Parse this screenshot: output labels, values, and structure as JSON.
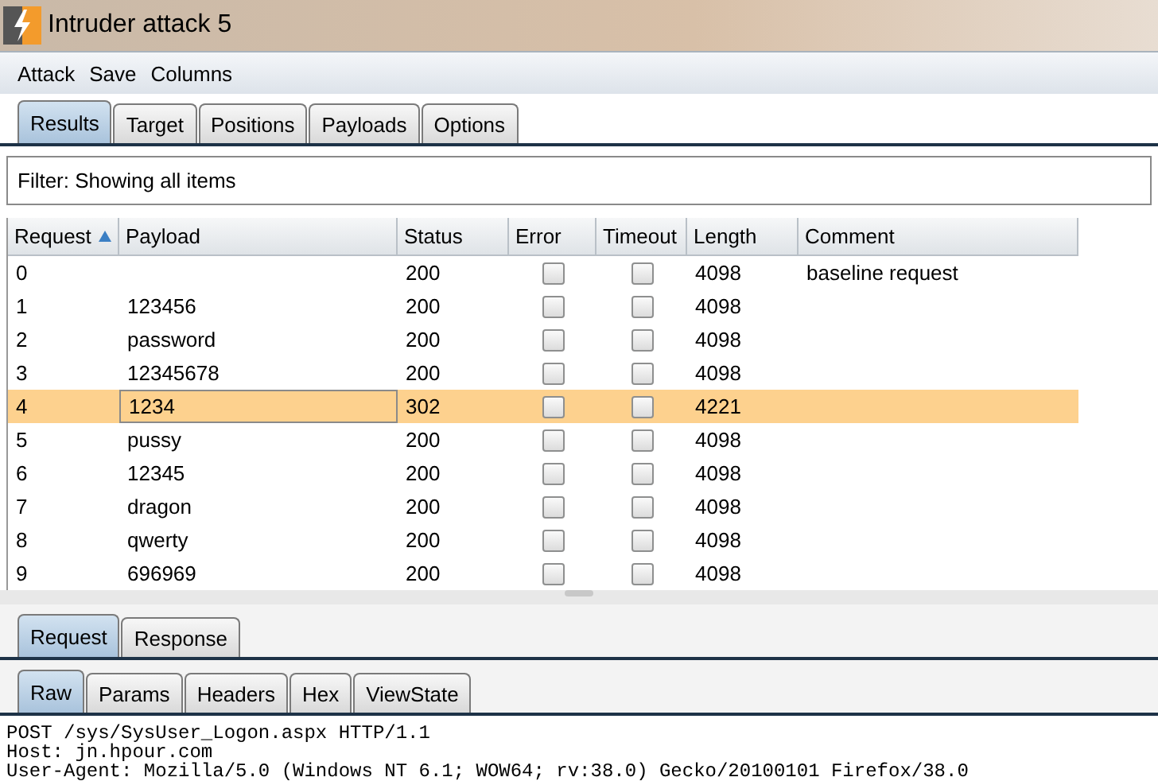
{
  "window": {
    "title": "Intruder attack 5"
  },
  "menu": [
    "Attack",
    "Save",
    "Columns"
  ],
  "tabs": [
    {
      "label": "Results",
      "selected": true
    },
    {
      "label": "Target",
      "selected": false
    },
    {
      "label": "Positions",
      "selected": false
    },
    {
      "label": "Payloads",
      "selected": false
    },
    {
      "label": "Options",
      "selected": false
    }
  ],
  "filter": "Filter: Showing all items",
  "table": {
    "columns": [
      {
        "label": "Request",
        "sorted": true
      },
      {
        "label": "Payload",
        "sorted": false
      },
      {
        "label": "Status",
        "sorted": false
      },
      {
        "label": "Error",
        "sorted": false
      },
      {
        "label": "Timeout",
        "sorted": false
      },
      {
        "label": "Length",
        "sorted": false
      },
      {
        "label": "Comment",
        "sorted": false
      }
    ],
    "rows": [
      {
        "request": "0",
        "payload": "",
        "status": "200",
        "error": false,
        "timeout": false,
        "length": "4098",
        "comment": "baseline request",
        "selected": false
      },
      {
        "request": "1",
        "payload": "123456",
        "status": "200",
        "error": false,
        "timeout": false,
        "length": "4098",
        "comment": "",
        "selected": false
      },
      {
        "request": "2",
        "payload": "password",
        "status": "200",
        "error": false,
        "timeout": false,
        "length": "4098",
        "comment": "",
        "selected": false
      },
      {
        "request": "3",
        "payload": "12345678",
        "status": "200",
        "error": false,
        "timeout": false,
        "length": "4098",
        "comment": "",
        "selected": false
      },
      {
        "request": "4",
        "payload": "1234",
        "status": "302",
        "error": false,
        "timeout": false,
        "length": "4221",
        "comment": "",
        "selected": true
      },
      {
        "request": "5",
        "payload": "pussy",
        "status": "200",
        "error": false,
        "timeout": false,
        "length": "4098",
        "comment": "",
        "selected": false
      },
      {
        "request": "6",
        "payload": "12345",
        "status": "200",
        "error": false,
        "timeout": false,
        "length": "4098",
        "comment": "",
        "selected": false
      },
      {
        "request": "7",
        "payload": "dragon",
        "status": "200",
        "error": false,
        "timeout": false,
        "length": "4098",
        "comment": "",
        "selected": false
      },
      {
        "request": "8",
        "payload": "qwerty",
        "status": "200",
        "error": false,
        "timeout": false,
        "length": "4098",
        "comment": "",
        "selected": false
      },
      {
        "request": "9",
        "payload": "696969",
        "status": "200",
        "error": false,
        "timeout": false,
        "length": "4098",
        "comment": "",
        "selected": false
      }
    ]
  },
  "message_tabs": [
    {
      "label": "Request",
      "selected": true
    },
    {
      "label": "Response",
      "selected": false
    }
  ],
  "view_tabs": [
    {
      "label": "Raw",
      "selected": true
    },
    {
      "label": "Params",
      "selected": false
    },
    {
      "label": "Headers",
      "selected": false
    },
    {
      "label": "Hex",
      "selected": false
    },
    {
      "label": "ViewState",
      "selected": false
    }
  ],
  "raw_lines": [
    "POST /sys/SysUser_Logon.aspx HTTP/1.1",
    "Host: jn.hpour.com",
    "User-Agent: Mozilla/5.0 (Windows NT 6.1; WOW64; rv:38.0) Gecko/20100101 Firefox/38.0"
  ]
}
